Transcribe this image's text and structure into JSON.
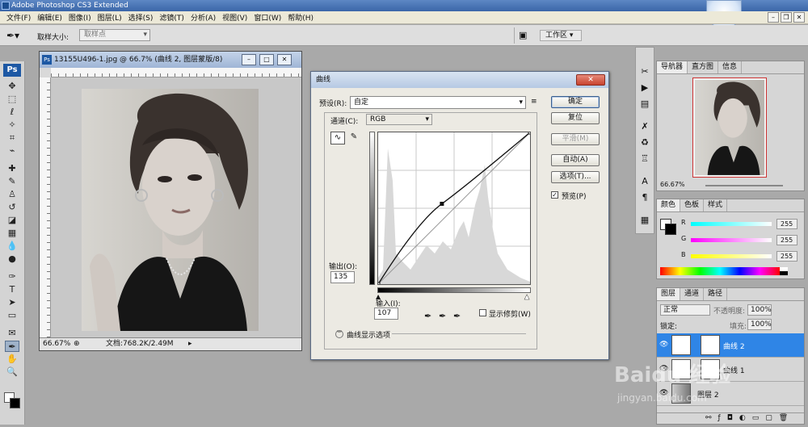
{
  "app": {
    "title": "Adobe Photoshop CS3 Extended"
  },
  "menu": [
    "文件(F)",
    "编辑(E)",
    "图像(I)",
    "图层(L)",
    "选择(S)",
    "滤镜(T)",
    "分析(A)",
    "视图(V)",
    "窗口(W)",
    "帮助(H)"
  ],
  "options": {
    "sample_label": "取样大小:",
    "sample_value": "取样点",
    "workspace": "工作区 ▾"
  },
  "document": {
    "title": "13155U496-1.jpg @ 66.7% (曲线 2, 图层蒙版/8)",
    "zoom": "66.67%",
    "doc_size": "文档:768.2K/2.49M"
  },
  "curves": {
    "title": "曲线",
    "close_label": "✕",
    "preset_label": "预设(R):",
    "preset_value": "自定",
    "channel_label": "通道(C):",
    "channel_value": "RGB",
    "output_label": "输出(O):",
    "output_value": "135",
    "input_label": "输入(I):",
    "input_value": "107",
    "show_clipping": "显示修剪(W)",
    "curve_options": "曲线显示选项",
    "buttons": {
      "ok": "确定",
      "reset": "复位",
      "smooth": "平滑(M)",
      "auto": "自动(A)",
      "options": "选项(T)...",
      "preview": "预览(P)"
    },
    "curve_points": [
      [
        0,
        0
      ],
      [
        107,
        135
      ],
      [
        255,
        255
      ]
    ],
    "histogram_color": "#d8d8d8"
  },
  "panels": {
    "navigator": {
      "tabs": [
        "导航器",
        "直方图",
        "信息"
      ],
      "zoom": "66.67%"
    },
    "color": {
      "tabs": [
        "颜色",
        "色板",
        "样式"
      ],
      "channels": [
        {
          "name": "R",
          "value": "255"
        },
        {
          "name": "G",
          "value": "255"
        },
        {
          "name": "B",
          "value": "255"
        }
      ]
    },
    "layers": {
      "tabs": [
        "图层",
        "通道",
        "路径"
      ],
      "blend_mode": "正常",
      "opacity_label": "不透明度:",
      "opacity": "100%",
      "lock_label": "锁定:",
      "fill_label": "填充:",
      "fill": "100%",
      "items": [
        {
          "name": "曲线 2",
          "selected": true
        },
        {
          "name": "曲线 1",
          "selected": false
        },
        {
          "name": "图层 2",
          "selected": false
        }
      ]
    }
  },
  "watermark": {
    "main": "Baidu 经验",
    "sub": "jingyan.baidu.com"
  }
}
